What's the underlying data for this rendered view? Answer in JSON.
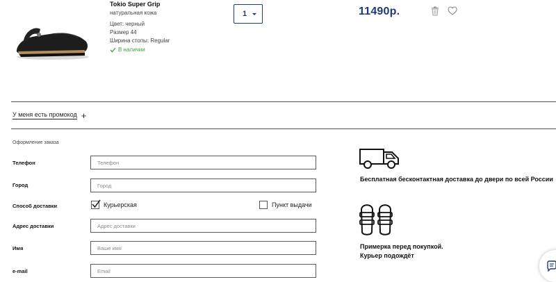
{
  "cart_item": {
    "name": "Tokio Super Grip",
    "material": "натуральная кожа",
    "color": "Цвет: черный",
    "size": "Размер 44",
    "width": "Ширина стопы: Regular",
    "stock": "В наличии",
    "quantity": "1",
    "price": "11490р."
  },
  "promo": {
    "label": "У меня есть промокод"
  },
  "order": {
    "title": "Оформление заказа",
    "fields": {
      "phone": {
        "label": "Телефон",
        "placeholder": "Телефон"
      },
      "city": {
        "label": "Город",
        "placeholder": "Город"
      },
      "delivery": {
        "label": "Способ доставки",
        "option_courier": "Курьерская",
        "option_pickup": "Пункт выдачи",
        "selected": "Курьерская"
      },
      "address": {
        "label": "Адрес доставки",
        "placeholder": "Адрес доставки"
      },
      "name": {
        "label": "Имя",
        "placeholder": "Ваше имя"
      },
      "email": {
        "label": "e-mail",
        "placeholder": "Email"
      }
    }
  },
  "features": {
    "delivery": "Бесплатная бесконтактная доставка до двери по всей России",
    "fitting_line1": "Примерка перед покупкой.",
    "fitting_line2": "Курьер подождёт"
  },
  "icons": {
    "van": "van-icon",
    "sandals": "sandals-icon",
    "trash": "trash-icon",
    "heart": "heart-icon",
    "chat": "chat-icon"
  },
  "colors": {
    "accent": "#1e3a78",
    "in_stock": "#3ca33c"
  }
}
